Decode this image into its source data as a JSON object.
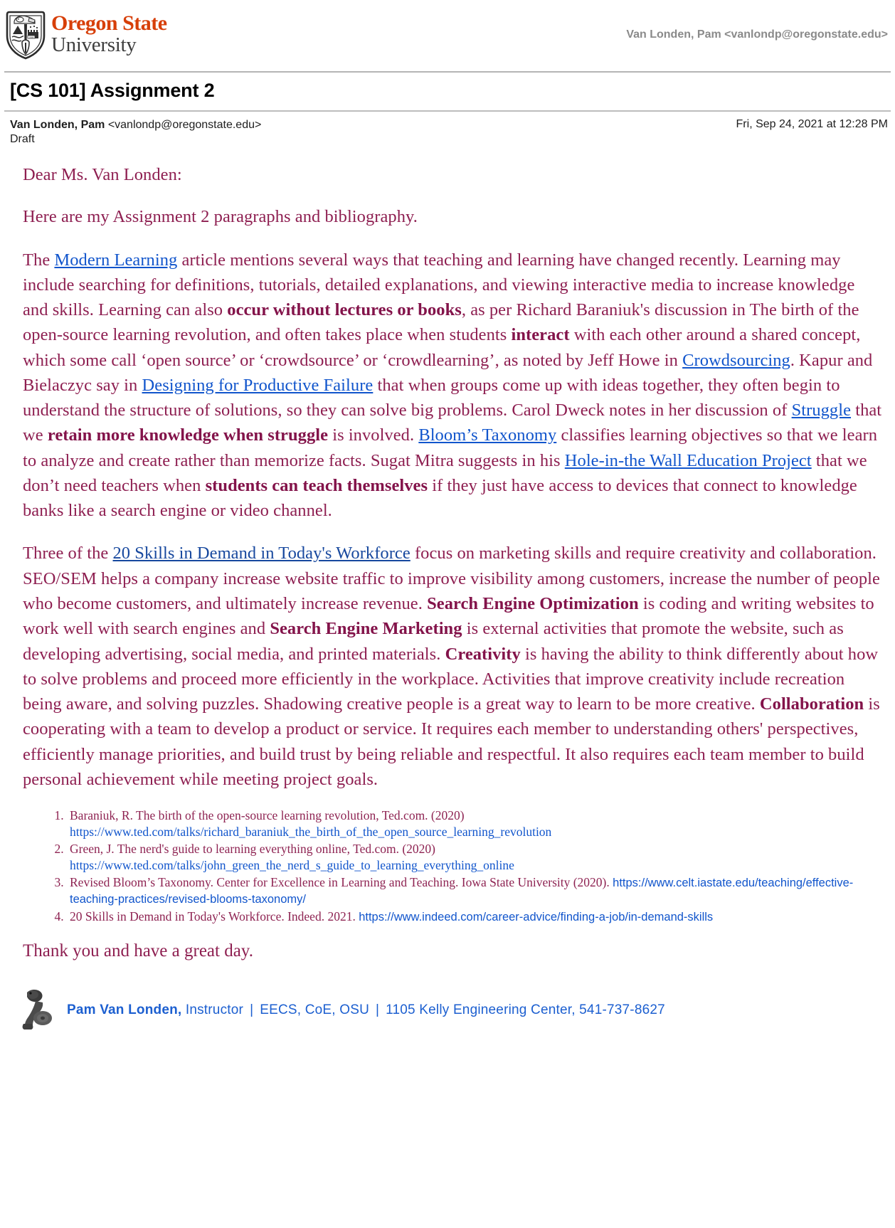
{
  "header": {
    "logo_primary": "Oregon State",
    "logo_secondary": "University",
    "logo_icon": "osu-shield-beaver-logo",
    "account": "Van Londen, Pam <vanlondp@oregonstate.edu>"
  },
  "subject": "[CS 101] Assignment 2",
  "meta": {
    "from_name": "Van Londen, Pam",
    "from_email": "<vanlondp@oregonstate.edu>",
    "status": "Draft",
    "date": "Fri, Sep 24, 2021 at 12:28 PM"
  },
  "body": {
    "greeting": "Dear Ms. Van Londen:",
    "intro": "Here are my Assignment 2 paragraphs and bibliography.",
    "p1": {
      "s1": "The ",
      "link1": "Modern Learning",
      "s2": " article mentions several ways that teaching and learning have changed recently. Learning may include searching for definitions, tutorials, detailed explanations, and viewing interactive media to increase knowledge and skills. Learning can also ",
      "b1": "occur without lectures or books",
      "s3": ", as per Richard Baraniuk's discussion in The birth of the open-source learning revolution, and often takes place when students ",
      "b2": "interact",
      "s4": " with each other around a shared concept, which some call ‘open source’ or ‘crowdsource’ or ‘crowdlearning’, as noted by Jeff Howe in ",
      "link2": "Crowdsourcing",
      "s5": ". Kapur and Bielaczyc say in ",
      "link3": "Designing for Productive Failure",
      "s6": " that when groups come up with ideas together, they often begin to understand the structure of solutions, so they can solve big problems. Carol Dweck notes in her discussion of ",
      "link4": "Struggle",
      "s7": " that we ",
      "b3": "retain more knowledge when struggle",
      "s8": " is involved. ",
      "link5": "Bloom’s Taxonomy",
      "s9": " classifies learning objectives so that we learn to analyze and create rather than memorize facts. Sugat Mitra suggests in his ",
      "link6": "Hole-in-the Wall Education Project",
      "s10": " that we don’t need teachers when ",
      "b4": "students can teach themselves",
      "s11": " if they just have access to devices that connect to knowledge banks like a search engine or video channel."
    },
    "p2": {
      "s1": "Three of the ",
      "link1": "20 Skills in Demand in Today's Workforce",
      "s2": " focus on marketing skills and require creativity and collaboration. SEO/SEM helps a company increase website traffic to improve visibility among customers, increase the number of people who become customers, and ultimately increase revenue. ",
      "b1": "Search Engine Optimization",
      "s3": " is coding and writing websites to work well with search engines and ",
      "b2": "Search Engine Marketing",
      "s4": " is external activities that promote the website, such as developing advertising, social media, and printed materials. ",
      "b3": "Creativity",
      "s5": " is having the ability to think differently about how to solve problems and proceed more efficiently in the workplace. Activities that improve creativity include recreation being aware, and solving puzzles. Shadowing creative people is a great way to learn to be more creative. ",
      "b4": "Collaboration",
      "s6": " is cooperating with a team to develop a product or service. It requires each member to understanding others' perspectives, efficiently manage priorities, and build trust by being reliable and respectful. It also requires each team member to build personal achievement while meeting project goals."
    },
    "closing": "Thank you and have a great day."
  },
  "bibliography": [
    {
      "text": "Baraniuk, R. The birth of the open-source learning revolution, Ted.com. (2020) ",
      "url": "https://www.ted.com/talks/richard_baraniuk_the_birth_of_the_open_source_learning_revolution",
      "url_style": "serif"
    },
    {
      "text": "Green, J. The nerd's guide to learning everything online, Ted.com. (2020) ",
      "url": "https://www.ted.com/talks/john_green_the_nerd_s_guide_to_learning_everything_online",
      "url_style": "serif"
    },
    {
      "text": "Revised Bloom’s Taxonomy. Center for Excellence in Learning and Teaching. Iowa State University (2020). ",
      "url": "https://www.celt.iastate.edu/teaching/effective-teaching-practices/revised-blooms-taxonomy/",
      "url_style": "sans"
    },
    {
      "text": "20 Skills in Demand in Today's Workforce. Indeed. 2021. ",
      "url": "https://www.indeed.com/career-advice/finding-a-job/in-demand-skills",
      "url_style": "sans"
    }
  ],
  "signature": {
    "icon": "osu-beaver-logo",
    "name": "Pam Van Londen",
    "comma": ",",
    "title": "Instructor",
    "sep1": "|",
    "dept": "EECS, CoE, OSU",
    "sep2": "|",
    "address": "1105 Kelly Engineering Center, 541-737-8627"
  },
  "colors": {
    "brand_orange": "#d73f09",
    "body_maroon": "#8e1f51",
    "link_blue": "#1155cc",
    "signature_blue": "#1c5fd0"
  }
}
